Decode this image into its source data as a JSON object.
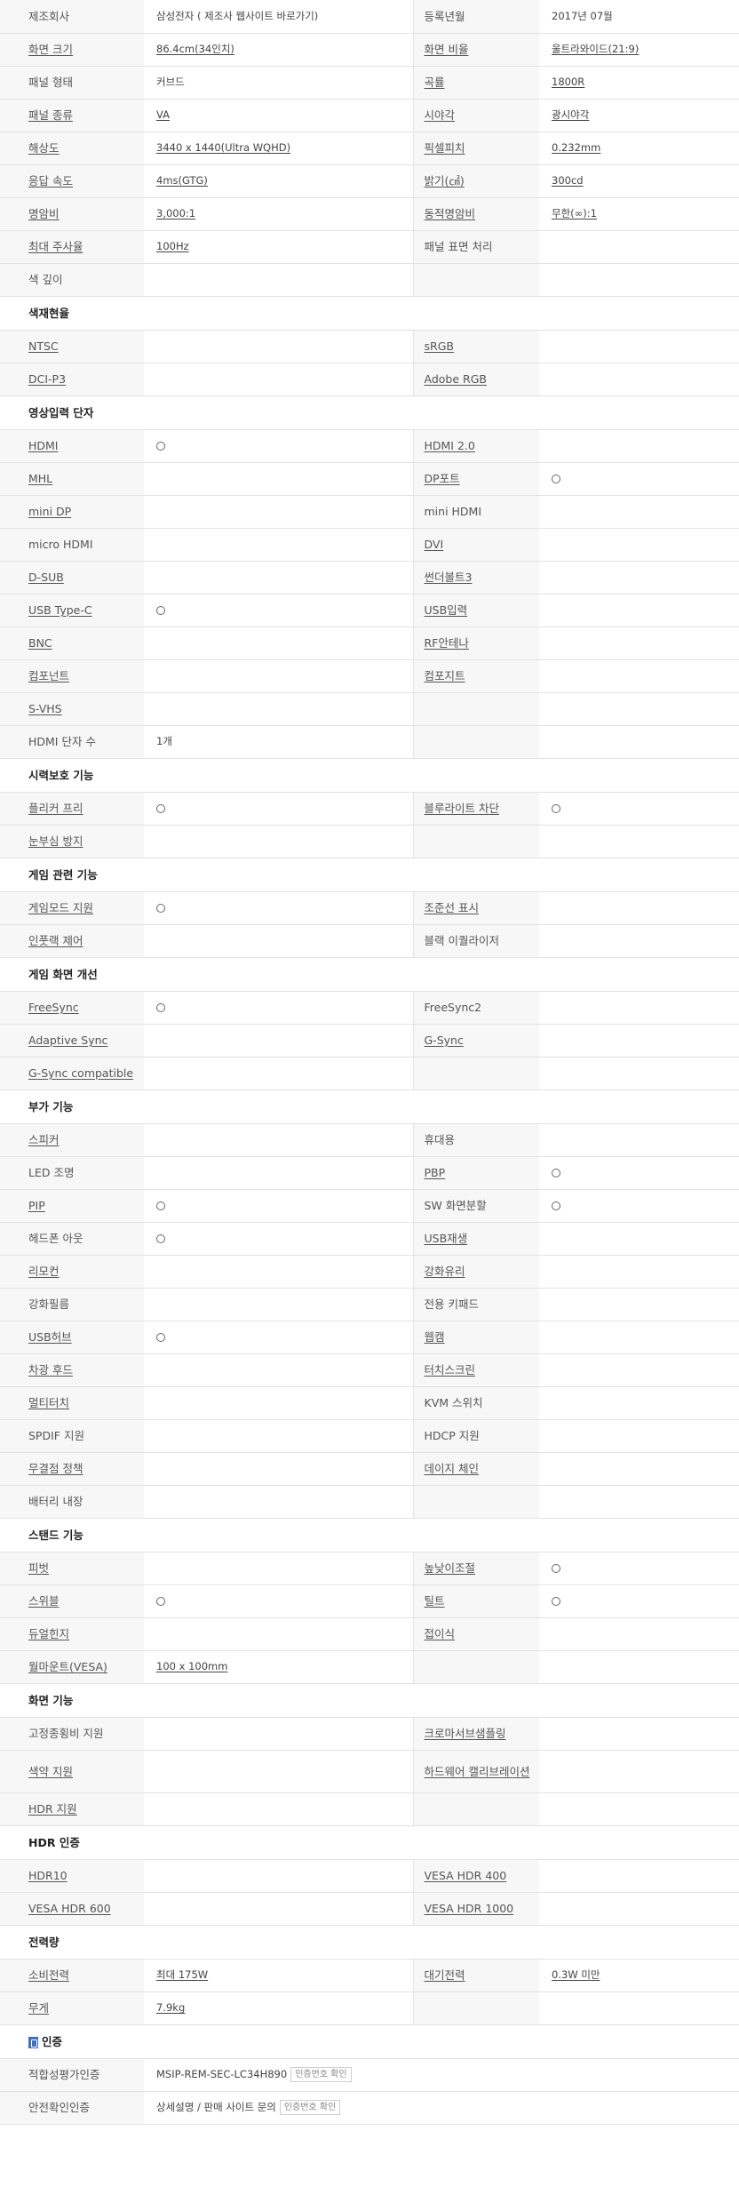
{
  "mark": "○",
  "sections": [
    {
      "rows": [
        [
          {
            "label": "제조회사"
          },
          {
            "value": "삼성전자 ( 제조사 웹사이트 바로가기)"
          },
          {
            "label": "등록년월"
          },
          {
            "value": "2017년 07월"
          }
        ],
        [
          {
            "label": "화면 크기",
            "link": true
          },
          {
            "value": "86.4cm(34인치)",
            "link": true
          },
          {
            "label": "화면 비율",
            "link": true
          },
          {
            "value": "울트라와이드(21:9)",
            "link": true
          }
        ],
        [
          {
            "label": "패널 형태"
          },
          {
            "value": "커브드"
          },
          {
            "label": "곡률",
            "link": true
          },
          {
            "value": "1800R",
            "link": true
          }
        ],
        [
          {
            "label": "패널 종류",
            "link": true
          },
          {
            "value": "VA",
            "link": true
          },
          {
            "label": "시야각",
            "link": true
          },
          {
            "value": "광시야각",
            "link": true
          }
        ],
        [
          {
            "label": "해상도",
            "link": true
          },
          {
            "value": "3440 x 1440(Ultra WQHD)",
            "link": true
          },
          {
            "label": "픽셀피치",
            "link": true
          },
          {
            "value": "0.232mm",
            "link": true
          }
        ],
        [
          {
            "label": "응답 속도",
            "link": true
          },
          {
            "value": "4ms(GTG)",
            "link": true
          },
          {
            "label": "밝기(㎠)",
            "link": true
          },
          {
            "value": "300cd",
            "link": true
          }
        ],
        [
          {
            "label": "명암비",
            "link": true
          },
          {
            "value": "3,000:1",
            "link": true
          },
          {
            "label": "동적명암비",
            "link": true
          },
          {
            "value": "무한(∞):1",
            "link": true
          }
        ],
        [
          {
            "label": "최대 주사율",
            "link": true
          },
          {
            "value": "100Hz",
            "link": true
          },
          {
            "label": "패널 표면 처리"
          },
          {
            "value": ""
          }
        ],
        [
          {
            "label": "색 깊이"
          },
          {
            "value": ""
          },
          {
            "label": ""
          },
          {
            "value": ""
          }
        ]
      ]
    },
    {
      "title": "색재현율",
      "rows": [
        [
          {
            "label": "NTSC",
            "link": true
          },
          {
            "value": ""
          },
          {
            "label": "sRGB",
            "link": true
          },
          {
            "value": ""
          }
        ],
        [
          {
            "label": "DCI-P3",
            "link": true
          },
          {
            "value": ""
          },
          {
            "label": "Adobe RGB",
            "link": true
          },
          {
            "value": ""
          }
        ]
      ]
    },
    {
      "title": "영상입력 단자",
      "rows": [
        [
          {
            "label": "HDMI",
            "link": true
          },
          {
            "mark": true
          },
          {
            "label": "HDMI 2.0",
            "link": true
          },
          {
            "value": ""
          }
        ],
        [
          {
            "label": "MHL",
            "link": true
          },
          {
            "value": ""
          },
          {
            "label": "DP포트",
            "link": true
          },
          {
            "mark": true
          }
        ],
        [
          {
            "label": "mini DP",
            "link": true
          },
          {
            "value": ""
          },
          {
            "label": "mini HDMI"
          },
          {
            "value": ""
          }
        ],
        [
          {
            "label": "micro HDMI"
          },
          {
            "value": ""
          },
          {
            "label": "DVI",
            "link": true
          },
          {
            "value": ""
          }
        ],
        [
          {
            "label": "D-SUB",
            "link": true
          },
          {
            "value": ""
          },
          {
            "label": "썬더볼트3",
            "link": true
          },
          {
            "value": ""
          }
        ],
        [
          {
            "label": "USB Type-C",
            "link": true
          },
          {
            "mark": true
          },
          {
            "label": "USB입력",
            "link": true
          },
          {
            "value": ""
          }
        ],
        [
          {
            "label": "BNC",
            "link": true
          },
          {
            "value": ""
          },
          {
            "label": "RF안테나",
            "link": true
          },
          {
            "value": ""
          }
        ],
        [
          {
            "label": "컴포넌트",
            "link": true
          },
          {
            "value": ""
          },
          {
            "label": "컴포지트",
            "link": true
          },
          {
            "value": ""
          }
        ],
        [
          {
            "label": "S-VHS",
            "link": true
          },
          {
            "value": ""
          },
          {
            "label": ""
          },
          {
            "value": ""
          }
        ],
        [
          {
            "label": "HDMI 단자 수"
          },
          {
            "value": "1개"
          },
          {
            "label": ""
          },
          {
            "value": ""
          }
        ]
      ]
    },
    {
      "title": "시력보호 기능",
      "rows": [
        [
          {
            "label": "플리커 프리",
            "link": true
          },
          {
            "mark": true
          },
          {
            "label": "블루라이트 차단",
            "link": true
          },
          {
            "mark": true
          }
        ],
        [
          {
            "label": "눈부심 방지",
            "link": true
          },
          {
            "value": ""
          },
          {
            "label": ""
          },
          {
            "value": ""
          }
        ]
      ]
    },
    {
      "title": "게임 관련 기능",
      "rows": [
        [
          {
            "label": "게임모드 지원",
            "link": true
          },
          {
            "mark": true
          },
          {
            "label": "조준선 표시",
            "link": true
          },
          {
            "value": ""
          }
        ],
        [
          {
            "label": "인풋랙 제어",
            "link": true
          },
          {
            "value": ""
          },
          {
            "label": "블랙 이퀄라이저"
          },
          {
            "value": ""
          }
        ]
      ]
    },
    {
      "title": "게임 화면 개선",
      "rows": [
        [
          {
            "label": "FreeSync",
            "link": true
          },
          {
            "mark": true
          },
          {
            "label": "FreeSync2"
          },
          {
            "value": ""
          }
        ],
        [
          {
            "label": "Adaptive Sync",
            "link": true
          },
          {
            "value": ""
          },
          {
            "label": "G-Sync",
            "link": true
          },
          {
            "value": ""
          }
        ],
        [
          {
            "label": "G-Sync compatible",
            "link": true
          },
          {
            "value": ""
          },
          {
            "label": ""
          },
          {
            "value": ""
          }
        ]
      ]
    },
    {
      "title": "부가 기능",
      "rows": [
        [
          {
            "label": "스피커",
            "link": true
          },
          {
            "value": ""
          },
          {
            "label": "휴대용"
          },
          {
            "value": ""
          }
        ],
        [
          {
            "label": "LED 조명"
          },
          {
            "value": ""
          },
          {
            "label": "PBP",
            "link": true
          },
          {
            "mark": true
          }
        ],
        [
          {
            "label": "PIP",
            "link": true
          },
          {
            "mark": true
          },
          {
            "label": "SW 화면분할"
          },
          {
            "mark": true
          }
        ],
        [
          {
            "label": "헤드폰 아웃"
          },
          {
            "mark": true
          },
          {
            "label": "USB재생",
            "link": true
          },
          {
            "value": ""
          }
        ],
        [
          {
            "label": "리모컨",
            "link": true
          },
          {
            "value": ""
          },
          {
            "label": "강화유리",
            "link": true
          },
          {
            "value": ""
          }
        ],
        [
          {
            "label": "강화필름"
          },
          {
            "value": ""
          },
          {
            "label": "전용 키패드"
          },
          {
            "value": ""
          }
        ],
        [
          {
            "label": "USB허브",
            "link": true
          },
          {
            "mark": true
          },
          {
            "label": "웹캠",
            "link": true
          },
          {
            "value": ""
          }
        ],
        [
          {
            "label": "차광 후드",
            "link": true
          },
          {
            "value": ""
          },
          {
            "label": "터치스크린",
            "link": true
          },
          {
            "value": ""
          }
        ],
        [
          {
            "label": "멀티터치",
            "link": true
          },
          {
            "value": ""
          },
          {
            "label": "KVM 스위치"
          },
          {
            "value": ""
          }
        ],
        [
          {
            "label": "SPDIF 지원"
          },
          {
            "value": ""
          },
          {
            "label": "HDCP 지원"
          },
          {
            "value": ""
          }
        ],
        [
          {
            "label": "무결점 정책",
            "link": true
          },
          {
            "value": ""
          },
          {
            "label": "데이지 체인",
            "link": true
          },
          {
            "value": ""
          }
        ],
        [
          {
            "label": "배터리 내장"
          },
          {
            "value": ""
          },
          {
            "label": ""
          },
          {
            "value": ""
          }
        ]
      ]
    },
    {
      "title": "스탠드 기능",
      "rows": [
        [
          {
            "label": "피벗",
            "link": true
          },
          {
            "value": ""
          },
          {
            "label": "높낮이조절",
            "link": true
          },
          {
            "mark": true
          }
        ],
        [
          {
            "label": "스위블",
            "link": true
          },
          {
            "mark": true
          },
          {
            "label": "틸트",
            "link": true
          },
          {
            "mark": true
          }
        ],
        [
          {
            "label": "듀얼힌지",
            "link": true
          },
          {
            "value": ""
          },
          {
            "label": "접이식",
            "link": true
          },
          {
            "value": ""
          }
        ],
        [
          {
            "label": "월마운트(VESA)",
            "link": true
          },
          {
            "value": "100 x 100mm",
            "link": true
          },
          {
            "label": ""
          },
          {
            "value": ""
          }
        ]
      ]
    },
    {
      "title": "화면 기능",
      "rows": [
        [
          {
            "label": "고정종횡비 지원"
          },
          {
            "value": ""
          },
          {
            "label": "크로마서브샘플링",
            "link": true
          },
          {
            "value": ""
          }
        ],
        [
          {
            "label": "색약 지원",
            "link": true
          },
          {
            "value": ""
          },
          {
            "label": "하드웨어 캘리브레이션",
            "link": true,
            "tall": true
          },
          {
            "value": ""
          }
        ],
        [
          {
            "label": "HDR 지원",
            "link": true
          },
          {
            "value": ""
          },
          {
            "label": ""
          },
          {
            "value": ""
          }
        ]
      ]
    },
    {
      "title": "HDR 인증",
      "rows": [
        [
          {
            "label": "HDR10",
            "link": true
          },
          {
            "value": ""
          },
          {
            "label": "VESA HDR 400",
            "link": true
          },
          {
            "value": ""
          }
        ],
        [
          {
            "label": "VESA HDR 600",
            "link": true
          },
          {
            "value": ""
          },
          {
            "label": "VESA HDR 1000",
            "link": true
          },
          {
            "value": ""
          }
        ]
      ]
    },
    {
      "title": "전력량",
      "rows": [
        [
          {
            "label": "소비전력",
            "link": true
          },
          {
            "value": "최대 175W",
            "link": true
          },
          {
            "label": "대기전력",
            "link": true
          },
          {
            "value": "0.3W 미만",
            "link": true
          }
        ],
        [
          {
            "label": "무게",
            "link": true
          },
          {
            "value": "7.9kg",
            "link": true
          },
          {
            "label": ""
          },
          {
            "value": ""
          }
        ]
      ]
    },
    {
      "title": "인증",
      "icon": "certification-icon",
      "rows": [
        [
          {
            "label": "적합성평가인증"
          },
          {
            "value": "MSIP-REM-SEC-LC34H890",
            "badge": "인증번호 확인",
            "span": true
          }
        ],
        [
          {
            "label": "안전확인인증"
          },
          {
            "value": "상세설명 / 판매 사이트 문의",
            "badge": "인증번호 확인",
            "span": true
          }
        ]
      ]
    }
  ]
}
